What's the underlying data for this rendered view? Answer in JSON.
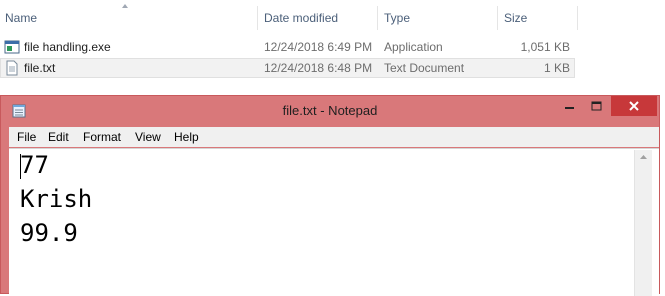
{
  "explorer": {
    "columns": {
      "name": "Name",
      "date_modified": "Date modified",
      "type": "Type",
      "size": "Size"
    },
    "files": [
      {
        "name": "file handling.exe",
        "date": "12/24/2018 6:49 PM",
        "type": "Application",
        "size": "1,051 KB",
        "icon": "exe-icon"
      },
      {
        "name": "file.txt",
        "date": "12/24/2018 6:48 PM",
        "type": "Text Document",
        "size": "1 KB",
        "icon": "text-file-icon"
      }
    ]
  },
  "notepad": {
    "title": "file.txt - Notepad",
    "menu": [
      "File",
      "Edit",
      "Format",
      "View",
      "Help"
    ],
    "content_lines": [
      "77",
      "Krish",
      "99.9"
    ],
    "colors": {
      "titlebar": "#d9787a",
      "close": "#c7383a"
    }
  }
}
